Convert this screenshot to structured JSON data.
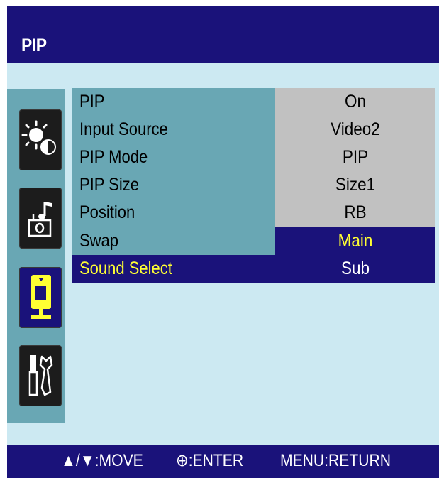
{
  "header": {
    "title": "PIP"
  },
  "sidebar": {
    "icons": [
      {
        "name": "picture-settings-icon",
        "active": false
      },
      {
        "name": "sound-settings-icon",
        "active": false
      },
      {
        "name": "pip-settings-icon",
        "active": true
      },
      {
        "name": "setup-tools-icon",
        "active": false
      }
    ]
  },
  "menu": {
    "rows": [
      {
        "label": "PIP",
        "value": "On"
      },
      {
        "label": "Input Source",
        "value": "Video2"
      },
      {
        "label": "PIP Mode",
        "value": "PIP"
      },
      {
        "label": "PIP Size",
        "value": "Size1"
      },
      {
        "label": "Position",
        "value": "RB"
      },
      {
        "label": "Swap",
        "value": "Main"
      },
      {
        "label": "Sound Select",
        "value": "Sub"
      }
    ],
    "selected_row": "Sound Select",
    "highlighted_value": "Main"
  },
  "footer": {
    "move": "▲/▼:MOVE",
    "enter": "⊕:ENTER",
    "return": "MENU:RETURN"
  },
  "colors": {
    "osd_background": "#cce9f2",
    "bar_navy": "#1a127a",
    "panel_teal": "#69a7b4",
    "value_gray": "#c1c1c1",
    "highlight_yellow": "#ffff33"
  }
}
